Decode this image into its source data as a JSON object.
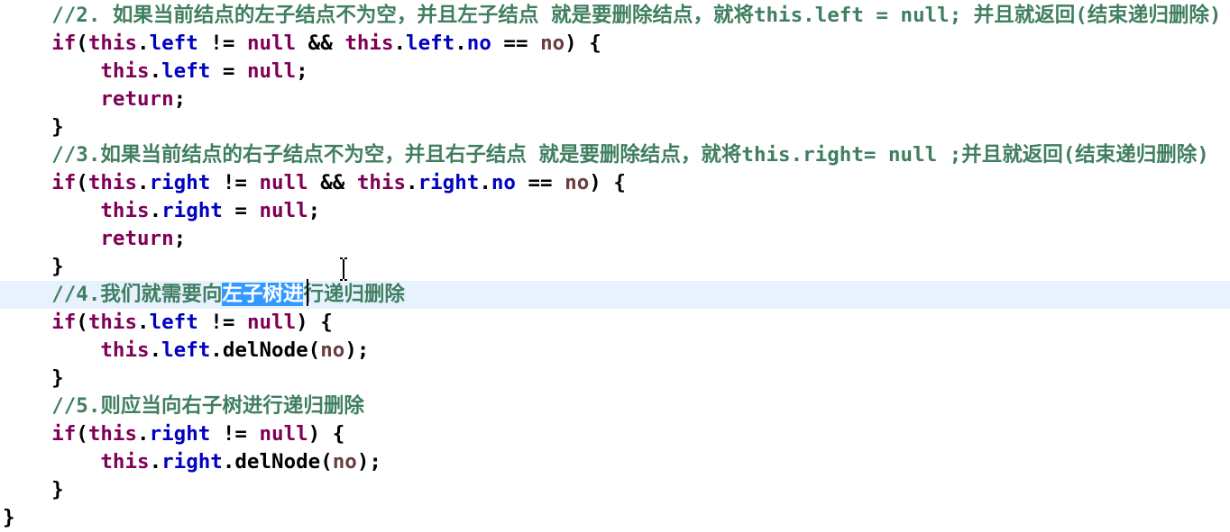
{
  "editor": {
    "language": "java",
    "lines": [
      [
        {
          "t": "    "
        },
        {
          "t": "//2. 如果当前结点的左子结点不为空，并且左子结点 就是要删除结点，就将this.left = null; 并且就返回(结束递归删除)",
          "c": "cmt"
        }
      ],
      [
        {
          "t": "    "
        },
        {
          "t": "if",
          "c": "kw"
        },
        {
          "t": "("
        },
        {
          "t": "this",
          "c": "kw"
        },
        {
          "t": "."
        },
        {
          "t": "left",
          "c": "fld"
        },
        {
          "t": " != "
        },
        {
          "t": "null",
          "c": "kw"
        },
        {
          "t": " && "
        },
        {
          "t": "this",
          "c": "kw"
        },
        {
          "t": "."
        },
        {
          "t": "left",
          "c": "fld"
        },
        {
          "t": "."
        },
        {
          "t": "no",
          "c": "fld"
        },
        {
          "t": " == "
        },
        {
          "t": "no",
          "c": "prm"
        },
        {
          "t": ") {"
        }
      ],
      [
        {
          "t": "        "
        },
        {
          "t": "this",
          "c": "kw"
        },
        {
          "t": "."
        },
        {
          "t": "left",
          "c": "fld"
        },
        {
          "t": " = "
        },
        {
          "t": "null",
          "c": "kw"
        },
        {
          "t": ";"
        }
      ],
      [
        {
          "t": "        "
        },
        {
          "t": "return",
          "c": "kw"
        },
        {
          "t": ";"
        }
      ],
      [
        {
          "t": "    }"
        }
      ],
      [
        {
          "t": "    "
        },
        {
          "t": "//3.如果当前结点的右子结点不为空，并且右子结点 就是要删除结点，就将this.right= null ;并且就返回(结束递归删除)",
          "c": "cmt"
        }
      ],
      [
        {
          "t": "    "
        },
        {
          "t": "if",
          "c": "kw"
        },
        {
          "t": "("
        },
        {
          "t": "this",
          "c": "kw"
        },
        {
          "t": "."
        },
        {
          "t": "right",
          "c": "fld"
        },
        {
          "t": " != "
        },
        {
          "t": "null",
          "c": "kw"
        },
        {
          "t": " && "
        },
        {
          "t": "this",
          "c": "kw"
        },
        {
          "t": "."
        },
        {
          "t": "right",
          "c": "fld"
        },
        {
          "t": "."
        },
        {
          "t": "no",
          "c": "fld"
        },
        {
          "t": " == "
        },
        {
          "t": "no",
          "c": "prm"
        },
        {
          "t": ") {"
        }
      ],
      [
        {
          "t": "        "
        },
        {
          "t": "this",
          "c": "kw"
        },
        {
          "t": "."
        },
        {
          "t": "right",
          "c": "fld"
        },
        {
          "t": " = "
        },
        {
          "t": "null",
          "c": "kw"
        },
        {
          "t": ";"
        }
      ],
      [
        {
          "t": "        "
        },
        {
          "t": "return",
          "c": "kw"
        },
        {
          "t": ";"
        }
      ],
      [
        {
          "t": "    }"
        }
      ],
      [
        {
          "t": "    "
        },
        {
          "t": "//4.我们就需要向",
          "c": "cmt"
        },
        {
          "t": "左子树进",
          "c": "sel"
        },
        {
          "t": "行递归删除",
          "c": "cmt"
        }
      ],
      [
        {
          "t": "    "
        },
        {
          "t": "if",
          "c": "kw"
        },
        {
          "t": "("
        },
        {
          "t": "this",
          "c": "kw"
        },
        {
          "t": "."
        },
        {
          "t": "left",
          "c": "fld"
        },
        {
          "t": " != "
        },
        {
          "t": "null",
          "c": "kw"
        },
        {
          "t": ") {"
        }
      ],
      [
        {
          "t": "        "
        },
        {
          "t": "this",
          "c": "kw"
        },
        {
          "t": "."
        },
        {
          "t": "left",
          "c": "fld"
        },
        {
          "t": ".delNode("
        },
        {
          "t": "no",
          "c": "prm"
        },
        {
          "t": ");"
        }
      ],
      [
        {
          "t": "    }"
        }
      ],
      [
        {
          "t": "    "
        },
        {
          "t": "//5.则应当向右子树进行递归删除",
          "c": "cmt"
        }
      ],
      [
        {
          "t": "    "
        },
        {
          "t": "if",
          "c": "kw"
        },
        {
          "t": "("
        },
        {
          "t": "this",
          "c": "kw"
        },
        {
          "t": "."
        },
        {
          "t": "right",
          "c": "fld"
        },
        {
          "t": " != "
        },
        {
          "t": "null",
          "c": "kw"
        },
        {
          "t": ") {"
        }
      ],
      [
        {
          "t": "        "
        },
        {
          "t": "this",
          "c": "kw"
        },
        {
          "t": "."
        },
        {
          "t": "right",
          "c": "fld"
        },
        {
          "t": ".delNode("
        },
        {
          "t": "no",
          "c": "prm"
        },
        {
          "t": ");"
        }
      ],
      [
        {
          "t": "    }"
        }
      ],
      [
        {
          "t": "}"
        }
      ]
    ],
    "current_line_index": 10,
    "selected_text": "左子树进",
    "colors": {
      "keyword": "#7f0055",
      "field": "#0000c0",
      "parameter": "#6a3e3e",
      "comment": "#3f7f5f",
      "current_line_highlight": "#e8f2fe",
      "selection": "#3399ff"
    }
  }
}
